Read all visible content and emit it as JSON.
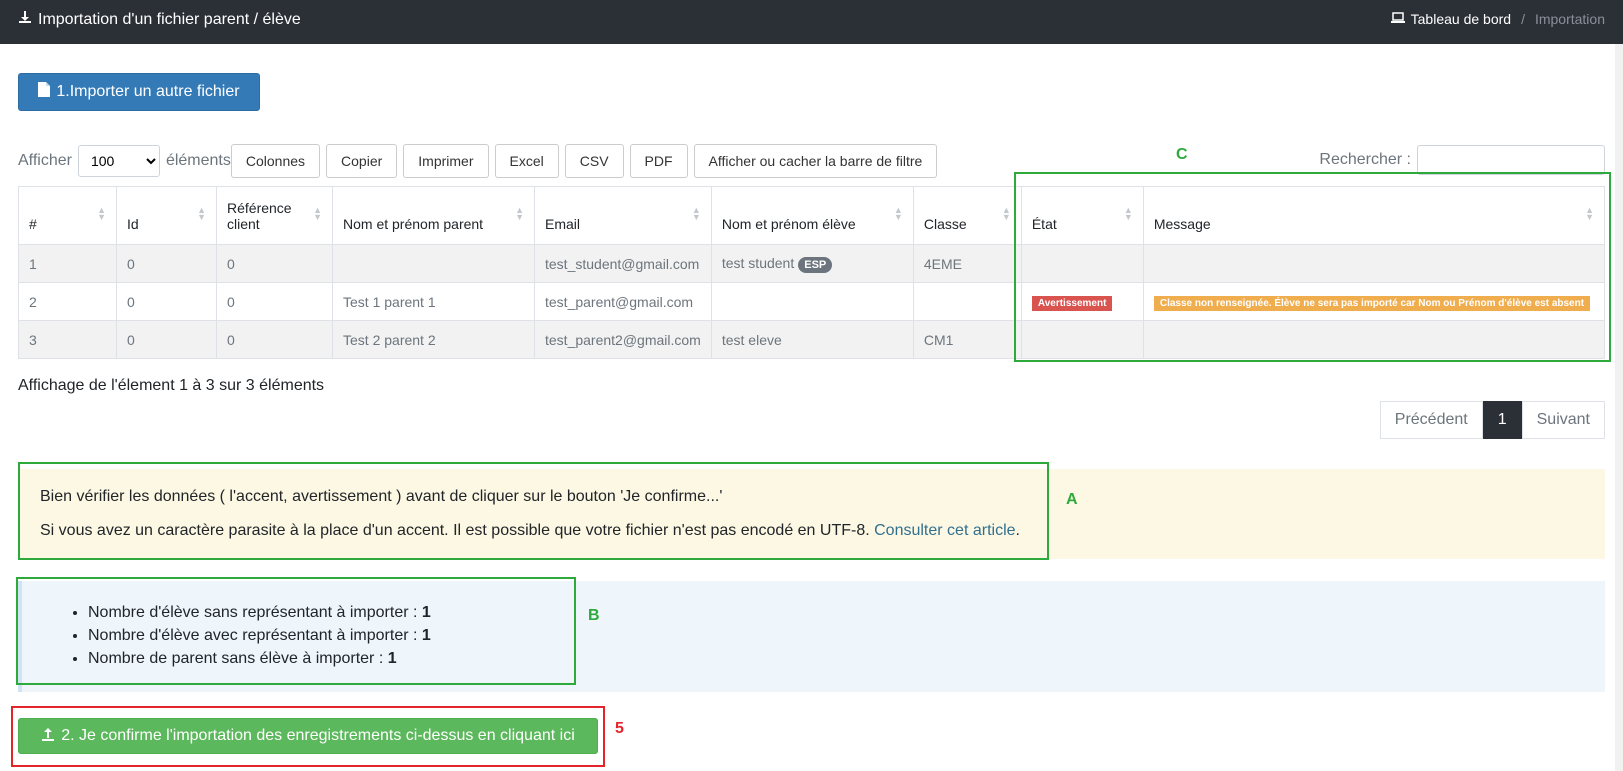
{
  "header": {
    "title": "Importation d'un fichier parent / élève",
    "breadcrumb_home": "Tableau de bord",
    "breadcrumb_sep": "/",
    "breadcrumb_current": "Importation"
  },
  "import_button": {
    "label": "1.Importer un autre fichier",
    "icon": "file-icon"
  },
  "toolbar": {
    "show_label": "Afficher",
    "page_size": "100",
    "page_size_suffix": "éléments",
    "buttons": [
      "Colonnes",
      "Copier",
      "Imprimer",
      "Excel",
      "CSV",
      "PDF",
      "Afficher ou cacher la barre de filtre"
    ],
    "search_label": "Rechercher :"
  },
  "table": {
    "headers": [
      "#",
      "Id",
      "Référence client",
      "Nom et prénom parent",
      "Email",
      "Nom et prénom élève",
      "Classe",
      "État",
      "Message"
    ],
    "rows": [
      {
        "num": "1",
        "id": "0",
        "ref": "0",
        "parent": "",
        "email": "test_student@gmail.com",
        "eleve": "test student",
        "eleve_badge": "ESP",
        "classe": "4EME",
        "etat": "",
        "message": ""
      },
      {
        "num": "2",
        "id": "0",
        "ref": "0",
        "parent": "Test 1 parent 1",
        "email": "test_parent@gmail.com",
        "eleve": "",
        "eleve_badge": "",
        "classe": "",
        "etat": "Avertissement",
        "message": "Classe non renseignée. Élève ne sera pas importé car Nom ou Prénom d'élève est absent"
      },
      {
        "num": "3",
        "id": "0",
        "ref": "0",
        "parent": "Test 2 parent 2",
        "email": "test_parent2@gmail.com",
        "eleve": "test eleve",
        "eleve_badge": "",
        "classe": "CM1",
        "etat": "",
        "message": ""
      }
    ]
  },
  "table_info": "Affichage de l'élement 1 à 3 sur 3 éléments",
  "pagination": {
    "prev": "Précédent",
    "current": "1",
    "next": "Suivant"
  },
  "warning": {
    "line1": "Bien vérifier les données ( l'accent, avertissement ) avant de cliquer sur le bouton 'Je confirme...'",
    "line2": "Si vous avez un caractère parasite à la place d'un accent. Il est possible que votre fichier n'est pas encodé en UTF-8.",
    "link": "Consulter cet article",
    "line2_end": "."
  },
  "summary": [
    {
      "label": "Nombre d'élève sans représentant à importer :",
      "value": "1"
    },
    {
      "label": "Nombre d'élève avec représentant à importer :",
      "value": "1"
    },
    {
      "label": "Nombre de parent sans élève à importer :",
      "value": "1"
    }
  ],
  "confirm_button": {
    "label": "2. Je confirme l'importation des enregistrements ci-dessus en cliquant ici",
    "icon": "upload-icon"
  },
  "annotations": {
    "a": "A",
    "b": "B",
    "c": "C",
    "five": "5"
  },
  "colors": {
    "topbar": "#2b2f36",
    "primary": "#337ab7",
    "success": "#5cb85c",
    "annotation_green": "#2eaa3c",
    "annotation_red": "#e3242b"
  }
}
